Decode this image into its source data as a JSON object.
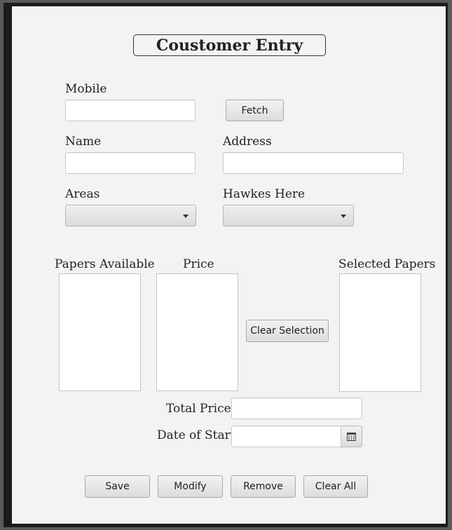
{
  "form": {
    "title": "Coustomer Entry",
    "mobile": {
      "label": "Mobile",
      "value": ""
    },
    "fetch_label": "Fetch",
    "name": {
      "label": "Name",
      "value": ""
    },
    "address": {
      "label": "Address",
      "value": ""
    },
    "areas": {
      "label": "Areas",
      "selected": ""
    },
    "hawker": {
      "label": "Hawkes Here",
      "selected": ""
    },
    "papers_available": {
      "label": "Papers Available",
      "items": []
    },
    "price": {
      "label": "Price",
      "items": []
    },
    "clear_selection_label": "Clear Selection",
    "selected_papers": {
      "label": "Selected Papers",
      "items": []
    },
    "total_price": {
      "label": "Total Price",
      "value": ""
    },
    "date_of_start": {
      "label": "Date of Start",
      "value": "",
      "icon": "calendar-icon"
    },
    "buttons": {
      "save": "Save",
      "modify": "Modify",
      "remove": "Remove",
      "clear_all": "Clear All"
    }
  },
  "colors": {
    "panel_background": "#f3f3f3",
    "window_border": "#1b1b1b",
    "outer_background": "#5a5a5a"
  }
}
